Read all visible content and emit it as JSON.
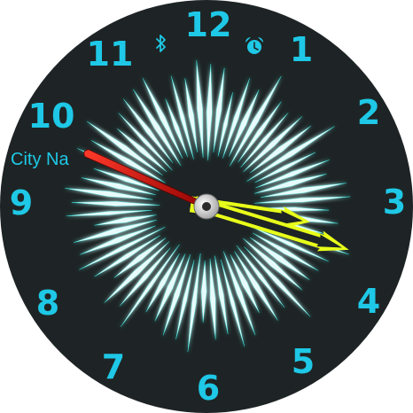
{
  "watch_face": {
    "numerals": [
      "12",
      "1",
      "2",
      "3",
      "4",
      "5",
      "6",
      "7",
      "8",
      "9",
      "10",
      "11"
    ],
    "city_label": "City Na",
    "status_icons": [
      "bluetooth-icon",
      "alarm-icon"
    ],
    "time": {
      "hour": 3,
      "minute": 17,
      "second": 49
    },
    "colors": {
      "background": "#1e2425",
      "numerals": "#1ec8e6",
      "rays": "#e8fbfb",
      "ray_glow": "#2fe0d8",
      "hands": "#e8ff1a",
      "second_hand": "#d81010",
      "icons": "#1ec8e6",
      "center_cap": "#cfcfcf"
    }
  }
}
